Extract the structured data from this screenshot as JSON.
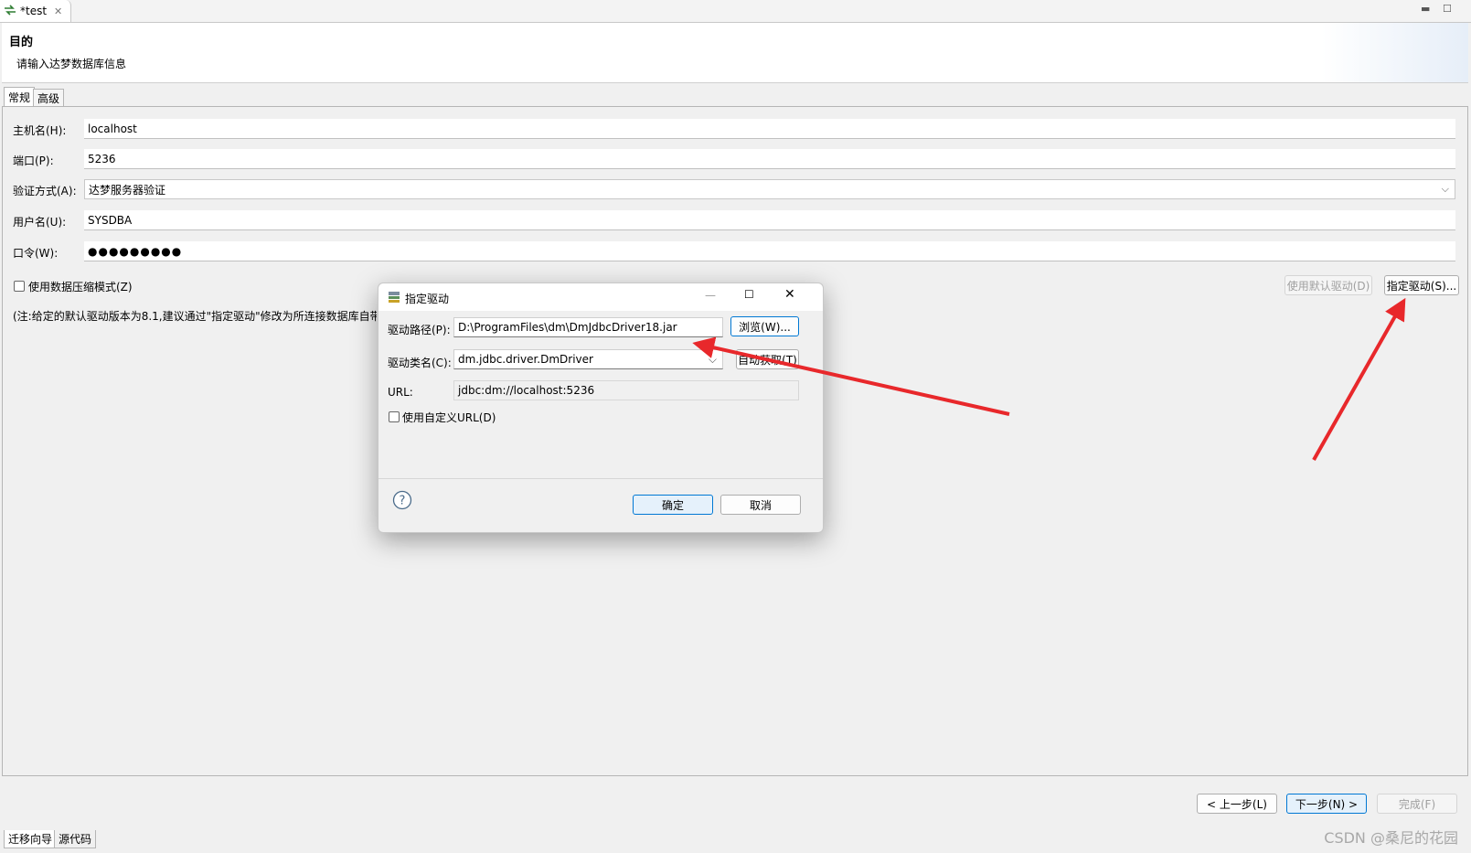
{
  "editor_tab": {
    "title": "*test"
  },
  "header": {
    "title": "目的",
    "description": "请输入达梦数据库信息"
  },
  "tabs": [
    {
      "label": "常规"
    },
    {
      "label": "高级"
    }
  ],
  "form": {
    "host_label": "主机名(H):",
    "host_value": "localhost",
    "port_label": "端口(P):",
    "port_value": "5236",
    "auth_label": "验证方式(A):",
    "auth_value": "达梦服务器验证",
    "user_label": "用户名(U):",
    "user_value": "SYSDBA",
    "password_label": "口令(W):",
    "password_value": "●●●●●●●●●",
    "compress_label": "使用数据压缩模式(Z)",
    "note": "(注:给定的默认驱动版本为8.1,建议通过\"指定驱动\"修改为所连接数据库自带",
    "default_driver_button": "使用默认驱动(D)",
    "specify_driver_button": "指定驱动(S)..."
  },
  "dialog": {
    "title": "指定驱动",
    "path_label": "驱动路径(P):",
    "path_value": "D:\\ProgramFiles\\dm\\DmJdbcDriver18.jar",
    "browse_button": "浏览(W)...",
    "class_label": "驱动类名(C):",
    "class_value": "dm.jdbc.driver.DmDriver",
    "auto_button": "自动获取(T)",
    "url_label": "URL:",
    "url_value": "jdbc:dm://localhost:5236",
    "custom_url_label": "使用自定义URL(D)",
    "ok_button": "确定",
    "cancel_button": "取消"
  },
  "wizard": {
    "back_button": "< 上一步(L)",
    "next_button": "下一步(N) >",
    "finish_button": "完成(F)"
  },
  "bottom_tabs": [
    {
      "label": "迁移向导"
    },
    {
      "label": "源代码"
    }
  ],
  "watermark": "CSDN @桑尼的花园",
  "colors": {
    "annotation_arrow": "#e8282b",
    "accent": "#0078d4"
  }
}
